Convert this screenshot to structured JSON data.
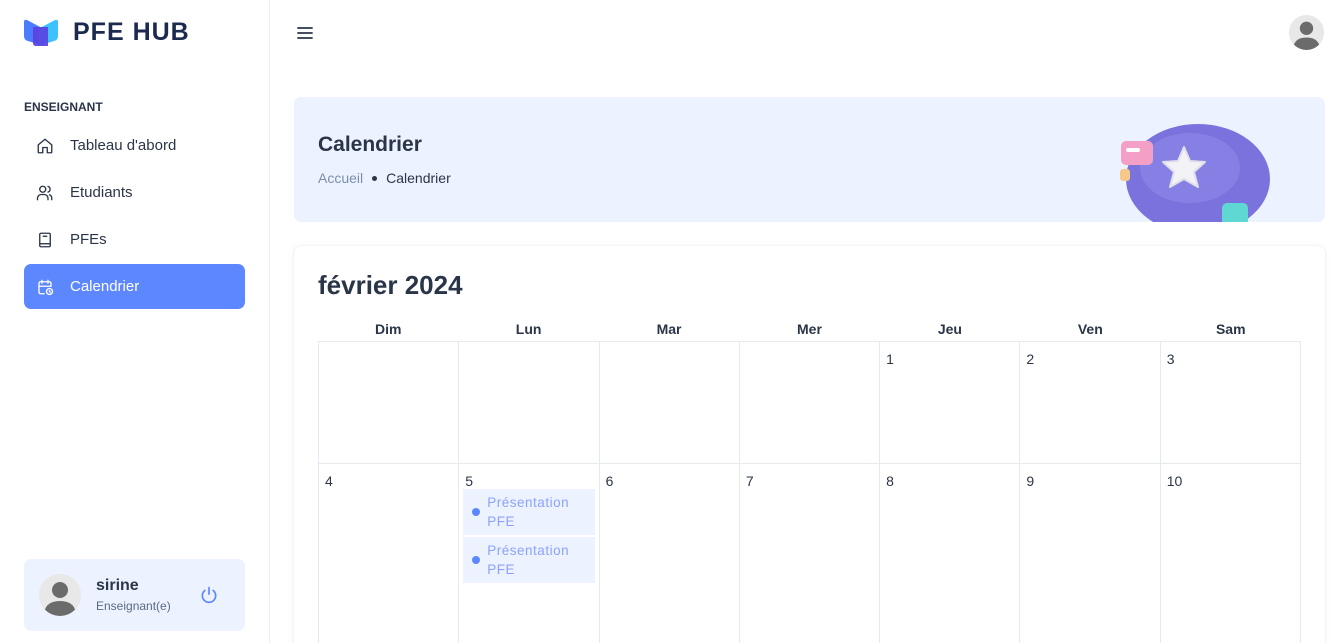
{
  "app": {
    "name": "PFE HUB"
  },
  "sidebar": {
    "section_title": "ENSEIGNANT",
    "items": [
      {
        "label": "Tableau d'abord",
        "icon": "home-icon",
        "active": false
      },
      {
        "label": "Etudiants",
        "icon": "users-icon",
        "active": false
      },
      {
        "label": "PFEs",
        "icon": "book-icon",
        "active": false
      },
      {
        "label": "Calendrier",
        "icon": "calendar-icon",
        "active": true
      }
    ],
    "profile": {
      "name": "sirine",
      "role": "Enseignant(e)"
    }
  },
  "banner": {
    "title": "Calendrier",
    "breadcrumb": {
      "home": "Accueil",
      "current": "Calendrier"
    }
  },
  "calendar": {
    "title": "février 2024",
    "weekdays": [
      "Dim",
      "Lun",
      "Mar",
      "Mer",
      "Jeu",
      "Ven",
      "Sam"
    ],
    "weeks": [
      [
        "",
        "",
        "",
        "",
        "1",
        "2",
        "3"
      ],
      [
        "4",
        "5",
        "6",
        "7",
        "8",
        "9",
        "10"
      ]
    ],
    "events": {
      "5": [
        "Présentation PFE",
        "Présentation PFE"
      ]
    }
  },
  "colors": {
    "primary": "#5d87ff",
    "light_primary": "#ecf2ff",
    "text": "#2a3547",
    "muted": "#7c8fac"
  }
}
